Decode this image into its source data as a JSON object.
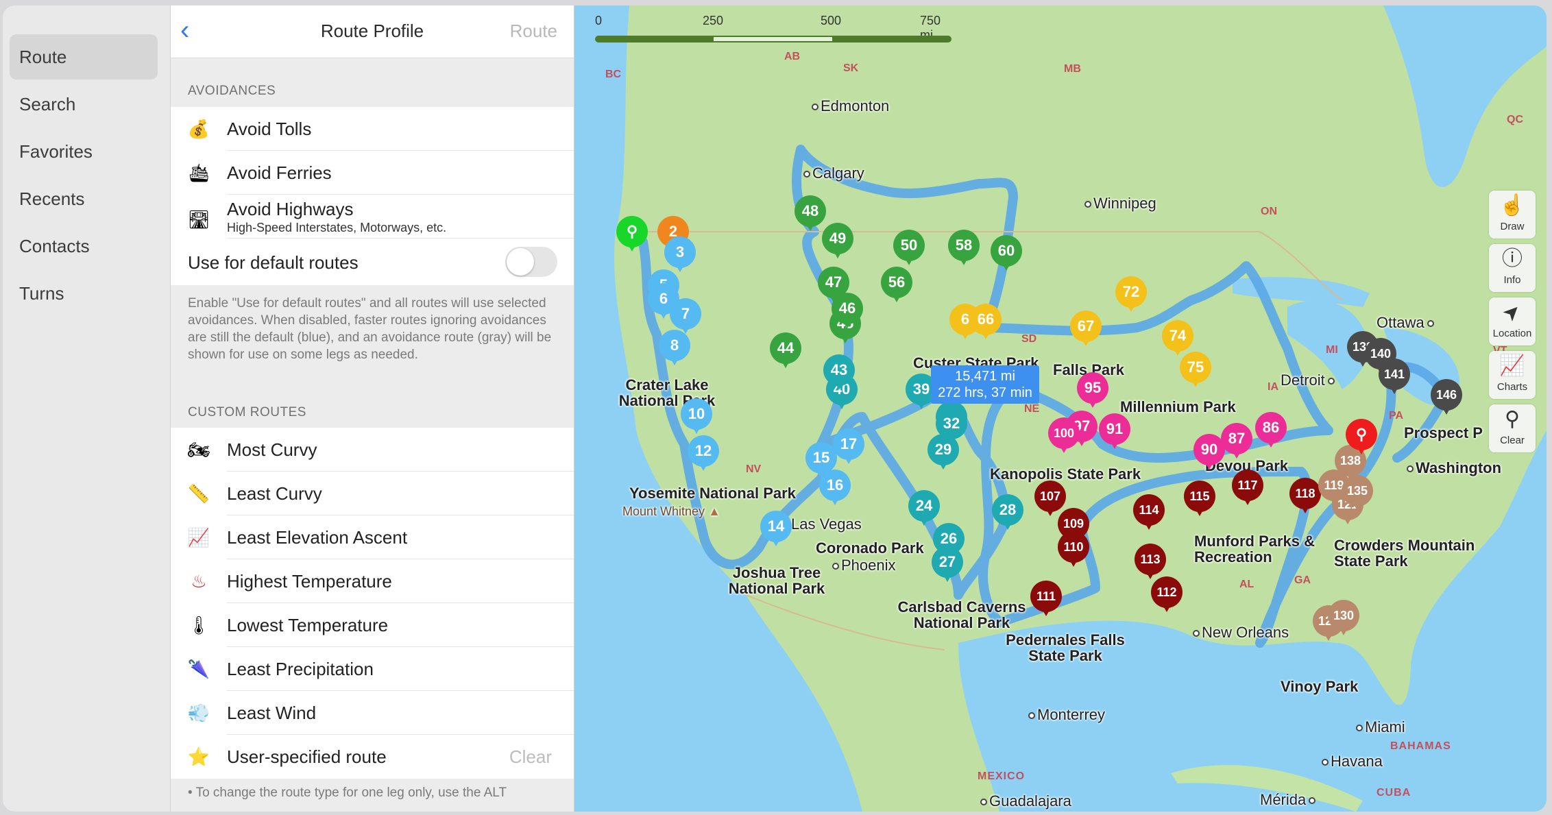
{
  "sidebar": {
    "items": [
      {
        "label": "Route",
        "active": true
      },
      {
        "label": "Search"
      },
      {
        "label": "Favorites"
      },
      {
        "label": "Recents"
      },
      {
        "label": "Contacts"
      },
      {
        "label": "Turns"
      }
    ]
  },
  "panel": {
    "title": "Route Profile",
    "back_icon": "chevron-left-icon",
    "right_button": "Route",
    "avoidances_header": "AVOIDANCES",
    "avoidances": [
      {
        "icon": "money-bag-icon",
        "glyph": "💰",
        "label": "Avoid Tolls"
      },
      {
        "icon": "ferry-icon",
        "glyph": "🛳",
        "label": "Avoid Ferries"
      },
      {
        "icon": "highway-icon",
        "glyph": "🛣",
        "label": "Avoid Highways",
        "sublabel": "High-Speed Interstates, Motorways, etc."
      }
    ],
    "default_routes": {
      "label": "Use for default routes",
      "enabled": false
    },
    "avoidances_note": "Enable \"Use for default routes\" and all routes will use selected avoidances. When disabled, faster routes ignoring avoidances are still the default (blue), and an avoidance route (gray) will be shown for use on some legs as needed.",
    "custom_header": "CUSTOM ROUTES",
    "custom_routes": [
      {
        "icon": "motorcycle-icon",
        "glyph": "🏍",
        "label": "Most Curvy"
      },
      {
        "icon": "ruler-icon",
        "glyph": "📏",
        "label": "Least Curvy"
      },
      {
        "icon": "chart-increasing-icon",
        "glyph": "📈",
        "label": "Least Elevation Ascent"
      },
      {
        "icon": "hot-springs-icon",
        "glyph": "♨",
        "label": "Highest Temperature"
      },
      {
        "icon": "thermometer-icon",
        "glyph": "🌡",
        "label": "Lowest Temperature"
      },
      {
        "icon": "umbrella-icon",
        "glyph": "🌂",
        "label": "Least Precipitation"
      },
      {
        "icon": "wind-icon",
        "glyph": "💨",
        "label": "Least Wind"
      },
      {
        "icon": "star-icon",
        "glyph": "⭐",
        "label": "User-specified route",
        "action": "Clear"
      }
    ],
    "footer_note": "• To change the route type for one leg only, use the ALT"
  },
  "map": {
    "scale": {
      "ticks": [
        "0",
        "250",
        "500",
        "750 mi"
      ]
    },
    "route_summary": {
      "distance": "15,471 mi",
      "duration": "272 hrs, 37 min"
    },
    "tools": [
      {
        "icon": "draw-hand-icon",
        "glyph": "☝",
        "label": "Draw"
      },
      {
        "icon": "info-icon",
        "glyph": "ⓘ",
        "label": "Info"
      },
      {
        "icon": "location-arrow-icon",
        "glyph": "➤",
        "label": "Location"
      },
      {
        "icon": "charts-icon",
        "glyph": "📈",
        "label": "Charts"
      },
      {
        "icon": "clear-pins-icon",
        "glyph": "⚲",
        "label": "Clear"
      }
    ],
    "colors": {
      "route": "#5aa7e8",
      "start": "#19d62a",
      "orange": "#f0871e",
      "lightblue": "#55b9f2",
      "teal": "#1fa9b1",
      "green": "#37a43f",
      "yellow": "#f4c01a",
      "pink": "#ec2d98",
      "maroon": "#8b0a0a",
      "tan": "#b8896a",
      "darkgray": "#4a4a4a",
      "end": "#ee1c1c"
    },
    "labels": {
      "cities": [
        "Edmonton",
        "Calgary",
        "Winnipeg",
        "Ottawa",
        "Detroit",
        "Washington",
        "Las Vegas",
        "Phoenix",
        "New Orleans",
        "Miami",
        "Havana",
        "Monterrey",
        "Guadalajara",
        "Mérida"
      ],
      "parks": [
        "Crater Lake National Park",
        "Yosemite National Park",
        "Joshua Tree National Park",
        "Coronado Park",
        "Carlsbad Caverns National Park",
        "Custer State Park",
        "Falls Park",
        "Millennium Park",
        "Kanopolis State Park",
        "Devou Park",
        "Munford Parks & Recreation",
        "Crowders Mountain State Park",
        "Pedernales Falls State Park",
        "Vinoy Park",
        "Prospect P"
      ],
      "peaks": [
        "Mount Whitney"
      ],
      "regions": [
        "BC",
        "AB",
        "SK",
        "MB",
        "ON",
        "QC",
        "NV",
        "SD",
        "NE",
        "IA",
        "MI",
        "PA",
        "VT",
        "AL",
        "GA"
      ],
      "countries": [
        "MEXICO",
        "BAHAMAS",
        "CUBA"
      ]
    },
    "pins": [
      {
        "label": "",
        "color": "start"
      },
      {
        "label": "2",
        "color": "orange"
      },
      {
        "label": "3",
        "color": "lightblue"
      },
      {
        "label": "5",
        "color": "lightblue"
      },
      {
        "label": "6",
        "color": "lightblue"
      },
      {
        "label": "7",
        "color": "lightblue"
      },
      {
        "label": "8",
        "color": "lightblue"
      },
      {
        "label": "10",
        "color": "lightblue"
      },
      {
        "label": "12",
        "color": "lightblue"
      },
      {
        "label": "14",
        "color": "lightblue"
      },
      {
        "label": "15",
        "color": "lightblue"
      },
      {
        "label": "16",
        "color": "lightblue"
      },
      {
        "label": "17",
        "color": "lightblue"
      },
      {
        "label": "24",
        "color": "teal"
      },
      {
        "label": "26",
        "color": "teal"
      },
      {
        "label": "27",
        "color": "teal"
      },
      {
        "label": "28",
        "color": "teal"
      },
      {
        "label": "29",
        "color": "teal"
      },
      {
        "label": "30",
        "color": "teal"
      },
      {
        "label": "32",
        "color": "teal"
      },
      {
        "label": "39",
        "color": "teal"
      },
      {
        "label": "40",
        "color": "teal"
      },
      {
        "label": "43",
        "color": "teal"
      },
      {
        "label": "44",
        "color": "green"
      },
      {
        "label": "45",
        "color": "green"
      },
      {
        "label": "46",
        "color": "green"
      },
      {
        "label": "47",
        "color": "green"
      },
      {
        "label": "48",
        "color": "green"
      },
      {
        "label": "49",
        "color": "green"
      },
      {
        "label": "50",
        "color": "green"
      },
      {
        "label": "56",
        "color": "green"
      },
      {
        "label": "58",
        "color": "green"
      },
      {
        "label": "60",
        "color": "green"
      },
      {
        "label": "6",
        "color": "yellow"
      },
      {
        "label": "66",
        "color": "yellow"
      },
      {
        "label": "67",
        "color": "yellow"
      },
      {
        "label": "72",
        "color": "yellow"
      },
      {
        "label": "74",
        "color": "yellow"
      },
      {
        "label": "75",
        "color": "yellow"
      },
      {
        "label": "86",
        "color": "pink"
      },
      {
        "label": "87",
        "color": "pink"
      },
      {
        "label": "90",
        "color": "pink"
      },
      {
        "label": "91",
        "color": "pink"
      },
      {
        "label": "95",
        "color": "pink"
      },
      {
        "label": "97",
        "color": "pink"
      },
      {
        "label": "100",
        "color": "pink"
      },
      {
        "label": "107",
        "color": "maroon"
      },
      {
        "label": "109",
        "color": "maroon"
      },
      {
        "label": "110",
        "color": "maroon"
      },
      {
        "label": "111",
        "color": "maroon"
      },
      {
        "label": "112",
        "color": "maroon"
      },
      {
        "label": "113",
        "color": "maroon"
      },
      {
        "label": "114",
        "color": "maroon"
      },
      {
        "label": "115",
        "color": "maroon"
      },
      {
        "label": "117",
        "color": "maroon"
      },
      {
        "label": "118",
        "color": "maroon"
      },
      {
        "label": "119",
        "color": "tan"
      },
      {
        "label": "121",
        "color": "tan"
      },
      {
        "label": "126",
        "color": "tan"
      },
      {
        "label": "130",
        "color": "tan"
      },
      {
        "label": "135",
        "color": "tan"
      },
      {
        "label": "138",
        "color": "tan"
      },
      {
        "label": "139",
        "color": "darkgray"
      },
      {
        "label": "140",
        "color": "darkgray"
      },
      {
        "label": "141",
        "color": "darkgray"
      },
      {
        "label": "146",
        "color": "darkgray"
      },
      {
        "label": "",
        "color": "end"
      }
    ]
  }
}
